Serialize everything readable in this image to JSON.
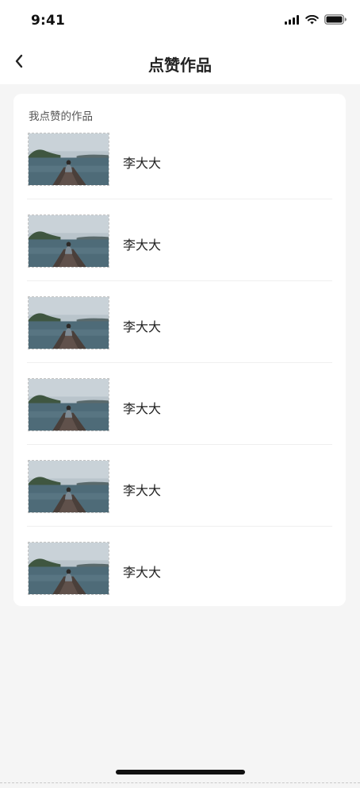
{
  "status_bar": {
    "time": "9:41",
    "icons": [
      "signal-icon",
      "wifi-icon",
      "battery-icon"
    ]
  },
  "nav": {
    "back_icon": "chevron-left-icon",
    "title": "点赞作品"
  },
  "section": {
    "label": "我点赞的作品"
  },
  "works": [
    {
      "title": "李大大"
    },
    {
      "title": "李大大"
    },
    {
      "title": "李大大"
    },
    {
      "title": "李大大"
    },
    {
      "title": "李大大"
    },
    {
      "title": "李大大"
    }
  ],
  "colors": {
    "page_background": "#f5f5f5",
    "card_background": "#ffffff",
    "text_primary": "#222222",
    "text_secondary": "#555555"
  }
}
